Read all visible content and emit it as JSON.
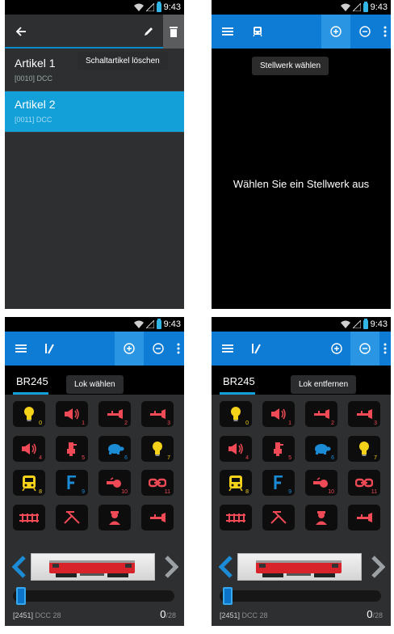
{
  "status_bar": {
    "time": "9:43"
  },
  "articles_screen": {
    "tooltip": "Schaltartikel löschen",
    "items": [
      {
        "name": "Artikel 1",
        "address": "[0010]",
        "protocol": "DCC",
        "selected": false
      },
      {
        "name": "Artikel 2",
        "address": "[0011]",
        "protocol": "DCC",
        "selected": true
      }
    ]
  },
  "stellwerk_screen": {
    "tooltip": "Stellwerk wählen",
    "message": "Wählen Sie ein Stellwerk aus"
  },
  "loco_screen_add": {
    "tab_label": "BR245",
    "tooltip": "Lok wählen",
    "address": "[2451]",
    "protocol": "DCC 28",
    "speed_value": "0",
    "speed_max": "/28"
  },
  "loco_screen_remove": {
    "tab_label": "BR245",
    "tooltip": "Lok entfernen",
    "address": "[2451]",
    "protocol": "DCC 28",
    "speed_value": "0",
    "speed_max": "/28"
  },
  "function_buttons": [
    {
      "number": "0",
      "icon": "light-bulb-icon",
      "color": "#f5d21a"
    },
    {
      "number": "1",
      "icon": "horn-speaker-icon",
      "color": "#ef4a55"
    },
    {
      "number": "2",
      "icon": "horn-icon",
      "color": "#ef4a55"
    },
    {
      "number": "3",
      "icon": "horn-icon",
      "color": "#ef4a55"
    },
    {
      "number": "4",
      "icon": "horn-speaker-icon",
      "color": "#ef4a55"
    },
    {
      "number": "5",
      "icon": "pump-icon",
      "color": "#ef4a55"
    },
    {
      "number": "6",
      "icon": "turtle-icon",
      "color": "#1b8bd6"
    },
    {
      "number": "7",
      "icon": "light-bulb-icon",
      "color": "#f5d21a"
    },
    {
      "number": "8",
      "icon": "cab-light-icon",
      "color": "#f5d21a"
    },
    {
      "number": "9",
      "icon": "function-f-icon",
      "color": "#1b8bd6"
    },
    {
      "number": "10",
      "icon": "whistle-icon",
      "color": "#ef4a55"
    },
    {
      "number": "11",
      "icon": "coupler-icon",
      "color": "#ef4a55"
    },
    {
      "number": "",
      "icon": "rails-icon",
      "color": "#ef4a55"
    },
    {
      "number": "",
      "icon": "pantograph-icon",
      "color": "#ef4a55"
    },
    {
      "number": "",
      "icon": "conductor-icon",
      "color": "#ef4a55"
    },
    {
      "number": "",
      "icon": "horn-icon",
      "color": "#ef4a55"
    }
  ]
}
